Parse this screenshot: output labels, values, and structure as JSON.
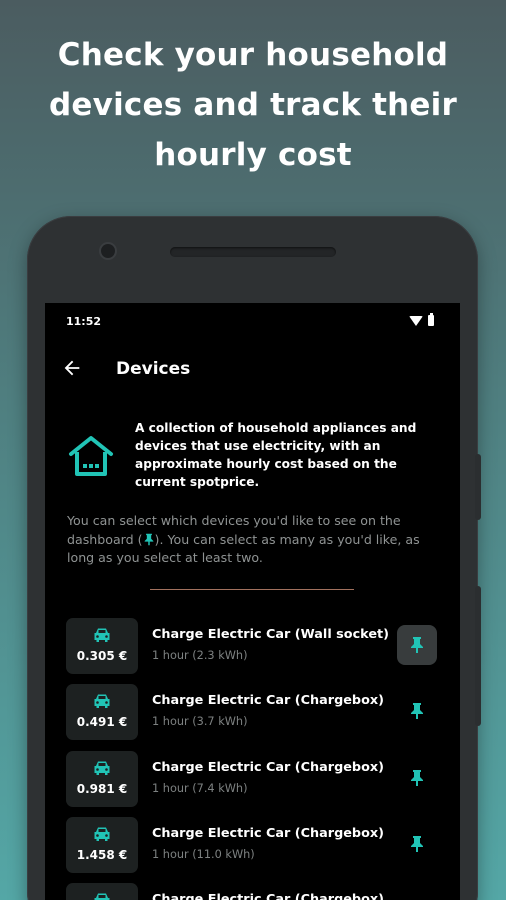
{
  "headline": {
    "line1": "Check your household",
    "line2": "devices and track their",
    "line3": "hourly cost"
  },
  "status_bar": {
    "time": "11:52",
    "icons": [
      "wifi-icon",
      "battery-icon"
    ]
  },
  "app_bar": {
    "back_icon": "arrow-left-icon",
    "title": "Devices"
  },
  "info": {
    "icon": "house-icon",
    "text": "A collection of household appliances and devices that use electricity, with an approximate hourly cost based on the current spotprice."
  },
  "hint": {
    "before": "You can select which devices you'd like to see on the dashboard (",
    "pin_icon": "pin-icon",
    "after": "). You can select as many as you'd like, as long as you select at least two."
  },
  "devices": [
    {
      "icon": "car-icon",
      "cost": "0.305 €",
      "name": "Charge Electric Car (Wall socket)",
      "detail": "1 hour (2.3 kWh)",
      "pinned": true
    },
    {
      "icon": "car-icon",
      "cost": "0.491 €",
      "name": "Charge Electric Car (Chargebox)",
      "detail": "1 hour (3.7 kWh)",
      "pinned": false
    },
    {
      "icon": "car-icon",
      "cost": "0.981 €",
      "name": "Charge Electric Car (Chargebox)",
      "detail": "1 hour (7.4 kWh)",
      "pinned": false
    },
    {
      "icon": "car-icon",
      "cost": "1.458 €",
      "name": "Charge Electric Car (Chargebox)",
      "detail": "1 hour (11.0 kWh)",
      "pinned": false
    },
    {
      "icon": "car-icon",
      "cost": "",
      "name": "Charge Electric Car (Chargebox)",
      "detail": "",
      "pinned": false
    }
  ],
  "colors": {
    "accent": "#21c4b6",
    "background": "#000000",
    "tile": "#1d2121",
    "divider": "#a2715e",
    "muted_text": "#8f9393"
  }
}
